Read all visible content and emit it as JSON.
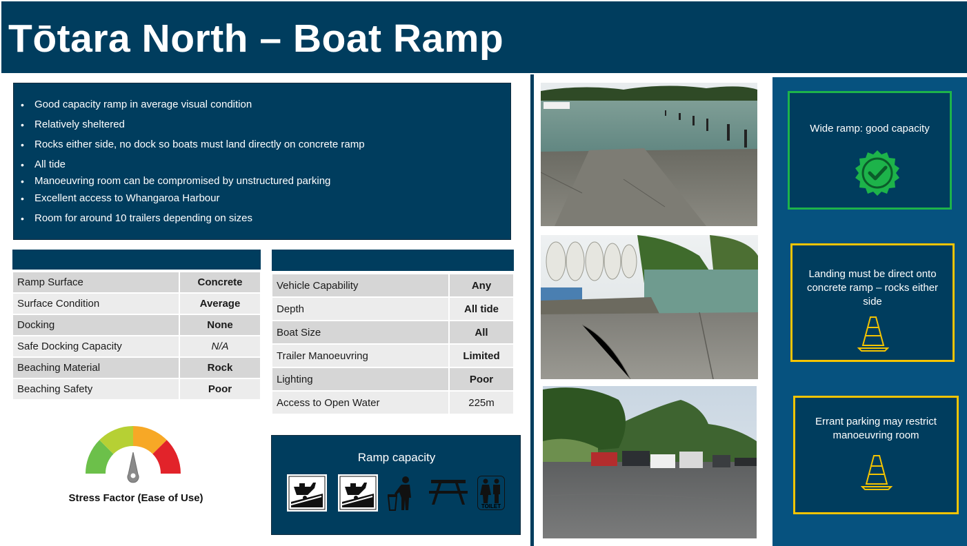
{
  "header": {
    "title": "Tōtara North – Boat Ramp"
  },
  "summary": {
    "bullets": [
      "Good capacity ramp in average visual condition",
      "Relatively sheltered",
      "Rocks either side, no dock so boats must land directly on concrete ramp",
      "All tide",
      "Manoeuvring room can be compromised by unstructured parking",
      "Excellent access to Whangaroa Harbour",
      "Room for around 10 trailers depending on sizes"
    ]
  },
  "left_table": {
    "heading": "",
    "rows": [
      {
        "label": "Ramp Surface",
        "value": "Concrete",
        "color": "#1a1a1a"
      },
      {
        "label": "Surface Condition",
        "value": "Average",
        "color": "#f5a21d"
      },
      {
        "label": "Docking",
        "value": "None",
        "color": "#e00d0d"
      },
      {
        "label": "Safe Docking Capacity",
        "value": "N/A",
        "color": "#1a1a1a"
      },
      {
        "label": "Beaching Material",
        "value": "Rock",
        "color": "#1a1a1a"
      },
      {
        "label": "Beaching Safety",
        "value": "Poor",
        "color": "#e00d0d"
      }
    ]
  },
  "right_table": {
    "heading": "",
    "rows": [
      {
        "label": "Vehicle Capability",
        "value": "Any",
        "color": "#00b050"
      },
      {
        "label": "Depth",
        "value": "All tide",
        "color": "#00b050"
      },
      {
        "label": "Boat Size",
        "value": "All",
        "color": "#00b050"
      },
      {
        "label": "Trailer Manoeuvring",
        "value": "Limited",
        "color": "#f5a21d"
      },
      {
        "label": "Lighting",
        "value": "Poor",
        "color": "#e00d0d"
      },
      {
        "label": "Access to Open Water",
        "value": "225m",
        "color": "#1a1a1a"
      }
    ]
  },
  "stress": {
    "label": "Stress Factor (Ease of Use)"
  },
  "capacity": {
    "title": "Ramp capacity",
    "icons": [
      "boat-ramp-icon",
      "boat-ramp-icon",
      "rubbish-bin-icon",
      "picnic-table-icon",
      "toilet-icon"
    ],
    "toilet_text": "TOILET"
  },
  "callouts": [
    {
      "text": "Wide ramp: good capacity",
      "border": "#1db34a",
      "icon": "check-badge-icon"
    },
    {
      "text": "Landing must be direct onto concrete ramp – rocks either side",
      "border": "#f5c400",
      "icon": "traffic-cone-icon"
    },
    {
      "text": "Errant parking may restrict manoeuvring room",
      "border": "#f5c400",
      "icon": "traffic-cone-icon"
    }
  ],
  "colors": {
    "navy": "#003d5e",
    "panel_blue": "#06527f",
    "green": "#00b050",
    "orange": "#f5a21d",
    "red": "#e00d0d",
    "yellow": "#f5c400"
  }
}
